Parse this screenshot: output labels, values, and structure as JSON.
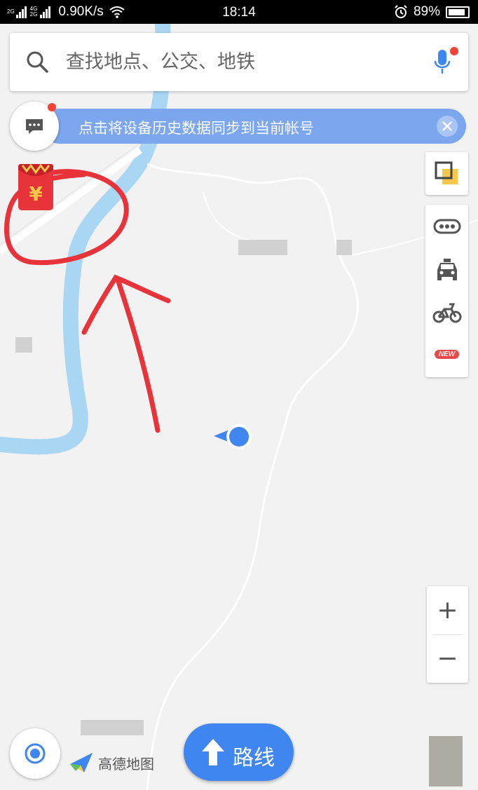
{
  "status_bar": {
    "net_top": "2G",
    "net_mid": "4G",
    "net_bottom": "2G",
    "speed": "0.90K/s",
    "time": "18:14",
    "battery": "89%",
    "battery_level": 0.89,
    "icons": [
      "signal-icon",
      "wifi-icon",
      "alarm-icon",
      "battery-icon"
    ]
  },
  "search": {
    "placeholder": "查找地点、公交、地铁",
    "icon": "search-icon",
    "voice_icon": "microphone-icon"
  },
  "sync_banner": {
    "text": "点击将设备历史数据同步到当前帐号",
    "icon": "message-icon",
    "close_icon": "close-icon"
  },
  "red_packet": {
    "symbol": "¥",
    "icon": "red-packet-icon"
  },
  "tools": {
    "layers_icon": "layers-icon",
    "items": [
      "traffic-icon",
      "taxi-icon",
      "bike-icon"
    ],
    "new_badge": "NEW"
  },
  "zoom": {
    "in": "+",
    "out": "−"
  },
  "bottom": {
    "locate_icon": "locate-icon",
    "logo_text": "高德地图",
    "route_label": "路线"
  },
  "colors": {
    "accent": "#3f86f0",
    "banner": "#7ca6ee",
    "river": "#a9d6f2",
    "map_bg": "#f2f2f2",
    "annotation": "#e8333a",
    "badge": "#f44336"
  }
}
